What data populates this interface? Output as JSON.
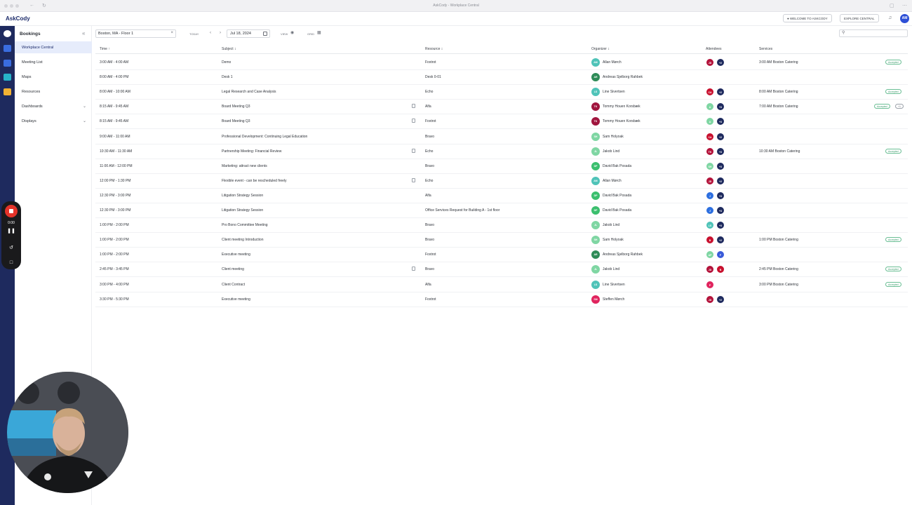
{
  "window": {
    "title": "AskCody - Workplace Central"
  },
  "app": {
    "brand": "AskCody"
  },
  "header": {
    "welcome_label": "WELCOME TO ASKCODY",
    "explore_label": "EXPLORE CENTRAL",
    "user_initials": "AM"
  },
  "sidebar": {
    "title": "Bookings",
    "items": [
      {
        "label": "Workplace Central",
        "active": true
      },
      {
        "label": "Meeting List"
      },
      {
        "label": "Maps"
      },
      {
        "label": "Resources"
      },
      {
        "label": "Dashboards"
      },
      {
        "label": "Displays"
      }
    ]
  },
  "toolbar": {
    "location": "Boston, MA - Floor 1",
    "today_label": "TODAY",
    "date": "Jul 18, 2024",
    "view_label": "VIEW",
    "grid_label": "GRID"
  },
  "table": {
    "columns": [
      "Time",
      "Subject",
      "Resource",
      "Organizer",
      "Attendees",
      "Services"
    ],
    "rows": [
      {
        "time": "3:00 AM - 4:00 AM",
        "subject": "Demo",
        "resource": "Foxtrot",
        "organizer": "Allan Mørch",
        "org_initials": "AM",
        "org_color": "#4fc3b8",
        "attendees": [
          {
            "t": "JD",
            "c": "#b3123a"
          },
          {
            "t": "+2",
            "c": "#1e2a5e"
          }
        ],
        "service": "3:00 AM  Boston Catering",
        "status": "Accepted",
        "doc": false
      },
      {
        "time": "8:00 AM - 4:00 PM",
        "subject": "Desk 1",
        "resource": "Desk 0-01",
        "organizer": "Andreas Sjelborg Rahbek",
        "org_initials": "AR",
        "org_color": "#2e8b57",
        "attendees": [],
        "service": "",
        "status": "",
        "doc": false
      },
      {
        "time": "8:00 AM - 10:00 AM",
        "subject": "Legal Research and Case Analysis",
        "resource": "Echo",
        "organizer": "Line Sivertsen",
        "org_initials": "LS",
        "org_color": "#4fc3b8",
        "attendees": [
          {
            "t": "CA",
            "c": "#c8102e"
          },
          {
            "t": "+2",
            "c": "#1e2a5e"
          }
        ],
        "service": "8:00 AM  Boston Catering",
        "status": "Accepted",
        "doc": false
      },
      {
        "time": "8:15 AM - 9:45 AM",
        "subject": "Board Meeting Q3",
        "resource": "Alfa",
        "organizer": "Tommy Houen Korsbæk",
        "org_initials": "TK",
        "org_color": "#a0153e",
        "attendees": [
          {
            "t": "A",
            "c": "#7fd6a3"
          },
          {
            "t": "+3",
            "c": "#1e2a5e"
          }
        ],
        "service": "7:00 AM  Boston Catering",
        "status": "Accepted",
        "extra": "+1",
        "doc": true
      },
      {
        "time": "8:15 AM - 9:45 AM",
        "subject": "Board Meeting Q3",
        "resource": "Foxtrot",
        "organizer": "Tommy Houen Korsbæk",
        "org_initials": "TK",
        "org_color": "#a0153e",
        "attendees": [
          {
            "t": "A",
            "c": "#7fd6a3"
          },
          {
            "t": "+3",
            "c": "#1e2a5e"
          }
        ],
        "service": "",
        "status": "",
        "doc": true
      },
      {
        "time": "9:00 AM - 11:00 AM",
        "subject": "Professional Development: Continuing Legal Education",
        "resource": "Bravo",
        "organizer": "Sam Holyoak",
        "org_initials": "SH",
        "org_color": "#7fd6a3",
        "attendees": [
          {
            "t": "CA",
            "c": "#c8102e"
          },
          {
            "t": "+2",
            "c": "#1e2a5e"
          }
        ],
        "service": "",
        "status": "",
        "doc": false
      },
      {
        "time": "10:30 AM - 11:30 AM",
        "subject": "Partnership Meeting: Financial Review",
        "resource": "Echo",
        "organizer": "Jakob Lind",
        "org_initials": "JL",
        "org_color": "#7fd6a3",
        "attendees": [
          {
            "t": "TK",
            "c": "#b3123a"
          },
          {
            "t": "+3",
            "c": "#1e2a5e"
          }
        ],
        "service": "10:30 AM  Boston Catering",
        "status": "Accepted",
        "doc": true
      },
      {
        "time": "11:00 AM - 12:00 PM",
        "subject": "Marketing: attract new clients",
        "resource": "Bravo",
        "organizer": "David Bak Posada",
        "org_initials": "DP",
        "org_color": "#3bbf6e",
        "attendees": [
          {
            "t": "SH",
            "c": "#7fd6a3"
          },
          {
            "t": "+3",
            "c": "#1e2a5e"
          }
        ],
        "service": "",
        "status": "",
        "doc": false
      },
      {
        "time": "12:00 PM - 1:30 PM",
        "subject": "Flexible event - can be rescheduled freely",
        "resource": "Echo",
        "organizer": "Allan Mørch",
        "org_initials": "AM",
        "org_color": "#4fc3b8",
        "attendees": [
          {
            "t": "JD",
            "c": "#b3123a"
          },
          {
            "t": "+2",
            "c": "#1e2a5e"
          }
        ],
        "service": "",
        "status": "",
        "doc": true
      },
      {
        "time": "12:30 PM - 3:00 PM",
        "subject": "Litigation Strategy Session",
        "resource": "Alfa",
        "organizer": "David Bak Posada",
        "org_initials": "DP",
        "org_color": "#3bbf6e",
        "attendees": [
          {
            "t": "J",
            "c": "#2d6fe0"
          },
          {
            "t": "+3",
            "c": "#1e2a5e"
          }
        ],
        "service": "",
        "status": "",
        "doc": false
      },
      {
        "time": "12:30 PM - 3:00 PM",
        "subject": "Litigation Strategy Session",
        "resource": "Office Services Request for Building A - 1st floor",
        "organizer": "David Bak Posada",
        "org_initials": "DP",
        "org_color": "#3bbf6e",
        "attendees": [
          {
            "t": "J",
            "c": "#2d6fe0"
          },
          {
            "t": "+3",
            "c": "#1e2a5e"
          }
        ],
        "service": "",
        "status": "",
        "doc": false
      },
      {
        "time": "1:00 PM - 2:00 PM",
        "subject": "Pro Bono Committee Meeting",
        "resource": "Bravo",
        "organizer": "Jakob Lind",
        "org_initials": "JL",
        "org_color": "#7fd6a3",
        "attendees": [
          {
            "t": "LS",
            "c": "#4fc3b8"
          },
          {
            "t": "+3",
            "c": "#1e2a5e"
          }
        ],
        "service": "",
        "status": "",
        "doc": false
      },
      {
        "time": "1:00 PM - 2:00 PM",
        "subject": "Client meeting Introduction",
        "resource": "Bravo",
        "organizer": "Sam Holyoak",
        "org_initials": "SH",
        "org_color": "#7fd6a3",
        "attendees": [
          {
            "t": "B",
            "c": "#c8102e"
          },
          {
            "t": "+2",
            "c": "#1e2a5e"
          }
        ],
        "service": "1:00 PM  Boston Catering",
        "status": "Accepted",
        "doc": false
      },
      {
        "time": "1:00 PM - 2:00 PM",
        "subject": "Executive meeting",
        "resource": "Foxtrot",
        "organizer": "Andreas Sjelborg Rahbek",
        "org_initials": "AR",
        "org_color": "#2e8b57",
        "attendees": [
          {
            "t": "AP",
            "c": "#7fd6a3"
          },
          {
            "t": "F",
            "c": "#3a5bd9"
          }
        ],
        "service": "",
        "status": "",
        "doc": false
      },
      {
        "time": "2:45 PM - 3:45 PM",
        "subject": "Client meeting",
        "resource": "Bravo",
        "organizer": "Jakob Lind",
        "org_initials": "JL",
        "org_color": "#7fd6a3",
        "attendees": [
          {
            "t": "JD",
            "c": "#b3123a"
          },
          {
            "t": "B",
            "c": "#c8102e"
          }
        ],
        "service": "2:45 PM  Boston Catering",
        "status": "Accepted",
        "doc": true
      },
      {
        "time": "3:00 PM - 4:00 PM",
        "subject": "Client Contract",
        "resource": "Alfa",
        "organizer": "Line Sivertsen",
        "org_initials": "LS",
        "org_color": "#4fc3b8",
        "attendees": [
          {
            "t": "P",
            "c": "#e0245e"
          }
        ],
        "service": "3:00 PM  Boston Catering",
        "status": "Accepted",
        "doc": false
      },
      {
        "time": "3:30 PM - 5:30 PM",
        "subject": "Executive meeting",
        "resource": "Foxtrot",
        "organizer": "Steffen Mørch",
        "org_initials": "SM",
        "org_color": "#e0245e",
        "attendees": [
          {
            "t": "JD",
            "c": "#b3123a"
          },
          {
            "t": "+2",
            "c": "#1e2a5e"
          }
        ],
        "service": "",
        "status": "",
        "doc": false
      }
    ]
  },
  "recorder": {
    "time": "0:00"
  },
  "colors": {
    "rail": "#1e2a5e",
    "accent": "#2d4fd6",
    "accepted": "#3b9a6b"
  }
}
